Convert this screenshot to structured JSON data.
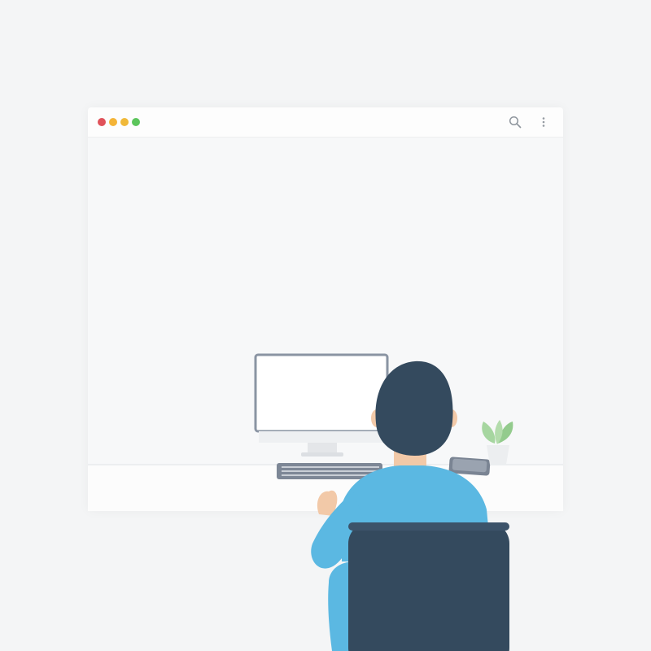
{
  "window": {
    "controls": [
      {
        "name": "close",
        "color": "#e0525a"
      },
      {
        "name": "minimize",
        "color": "#f4b437"
      },
      {
        "name": "maximize",
        "color": "#f0b93a"
      },
      {
        "name": "zoom",
        "color": "#5cc55c"
      }
    ],
    "toolbar_icons": [
      "search-icon",
      "more-vertical-icon"
    ]
  },
  "colors": {
    "background": "#f4f5f6",
    "shirt": "#5bb8e2",
    "hair": "#344a5e",
    "chair": "#344a5e",
    "monitor_frame": "#8a94a3",
    "keyboard": "#7d8796",
    "plant": "#9ccf96",
    "skin": "#f2c9a8"
  },
  "illustration": {
    "subject": "person-at-desk",
    "items": [
      "monitor",
      "keyboard",
      "phone",
      "plant",
      "chair"
    ]
  }
}
